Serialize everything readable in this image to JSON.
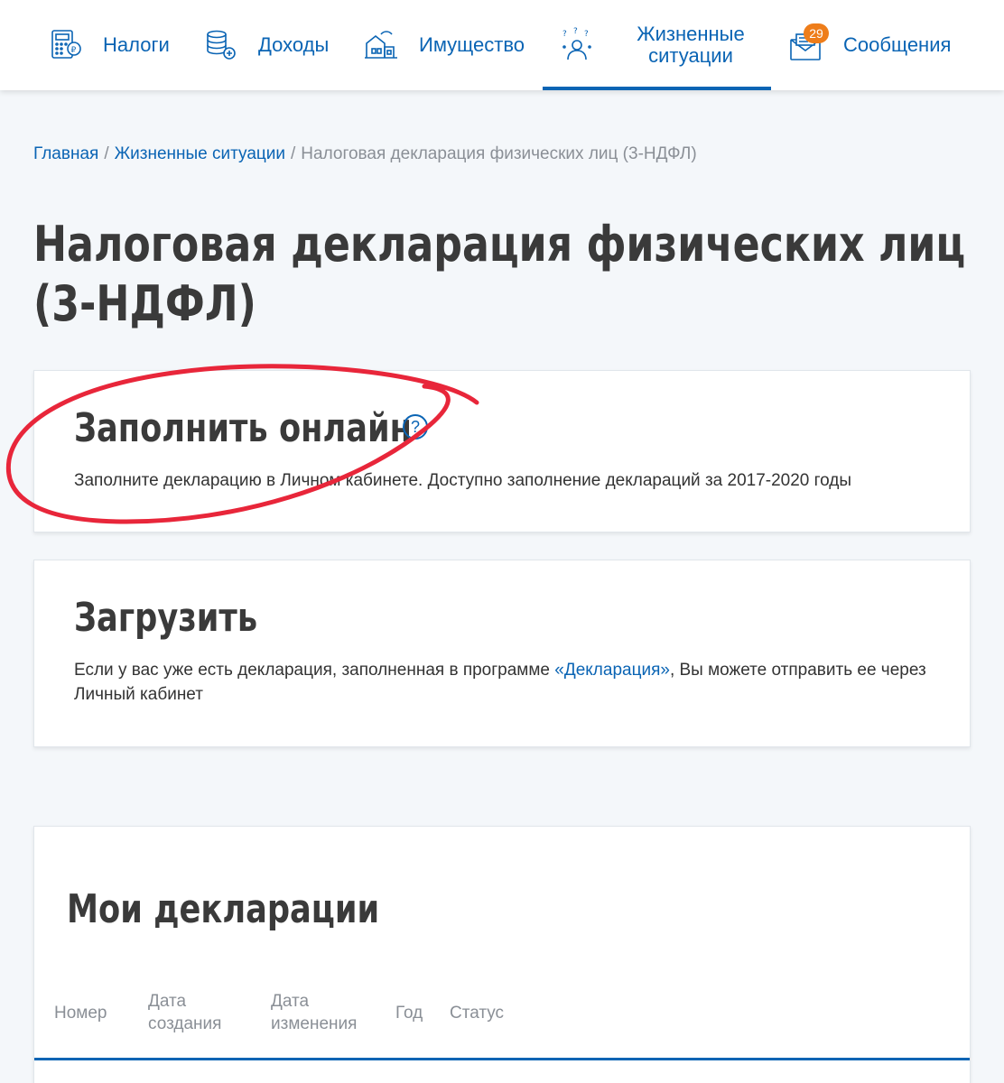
{
  "nav": {
    "items": [
      {
        "label": "Налоги",
        "icon": "tax-calculator-icon"
      },
      {
        "label": "Доходы",
        "icon": "coins-icon"
      },
      {
        "label": "Имущество",
        "icon": "property-icon"
      },
      {
        "label": "Жизненные ситуации",
        "icon": "life-situations-icon",
        "active": true
      },
      {
        "label": "Сообщения",
        "icon": "messages-icon"
      }
    ],
    "messages_badge": "29"
  },
  "breadcrumb": {
    "home": "Главная",
    "section": "Жизненные ситуации",
    "current": "Налоговая декларация физических лиц (3-НДФЛ)",
    "separator": "/"
  },
  "page": {
    "title": "Налоговая декларация физических лиц (3-НДФЛ)"
  },
  "fill_online": {
    "title": "Заполнить онлайн",
    "description": "Заполните декларацию в Личном кабинете. Доступно заполнение деклараций за 2017-2020 годы",
    "help_symbol": "?"
  },
  "upload": {
    "title": "Загрузить",
    "text_before": "Если у вас уже есть декларация, заполненная в программе ",
    "link": "«Декларация»",
    "text_after": ", Вы можете отправить ее через Личный кабинет"
  },
  "my_declarations": {
    "title": "Мои декларации",
    "columns": [
      "Номер",
      "Дата создания",
      "Дата изменения",
      "Год",
      "Статус"
    ]
  },
  "colors": {
    "accent": "#0a64b4",
    "badge": "#ee7d1a",
    "annotation": "#e8263a"
  }
}
